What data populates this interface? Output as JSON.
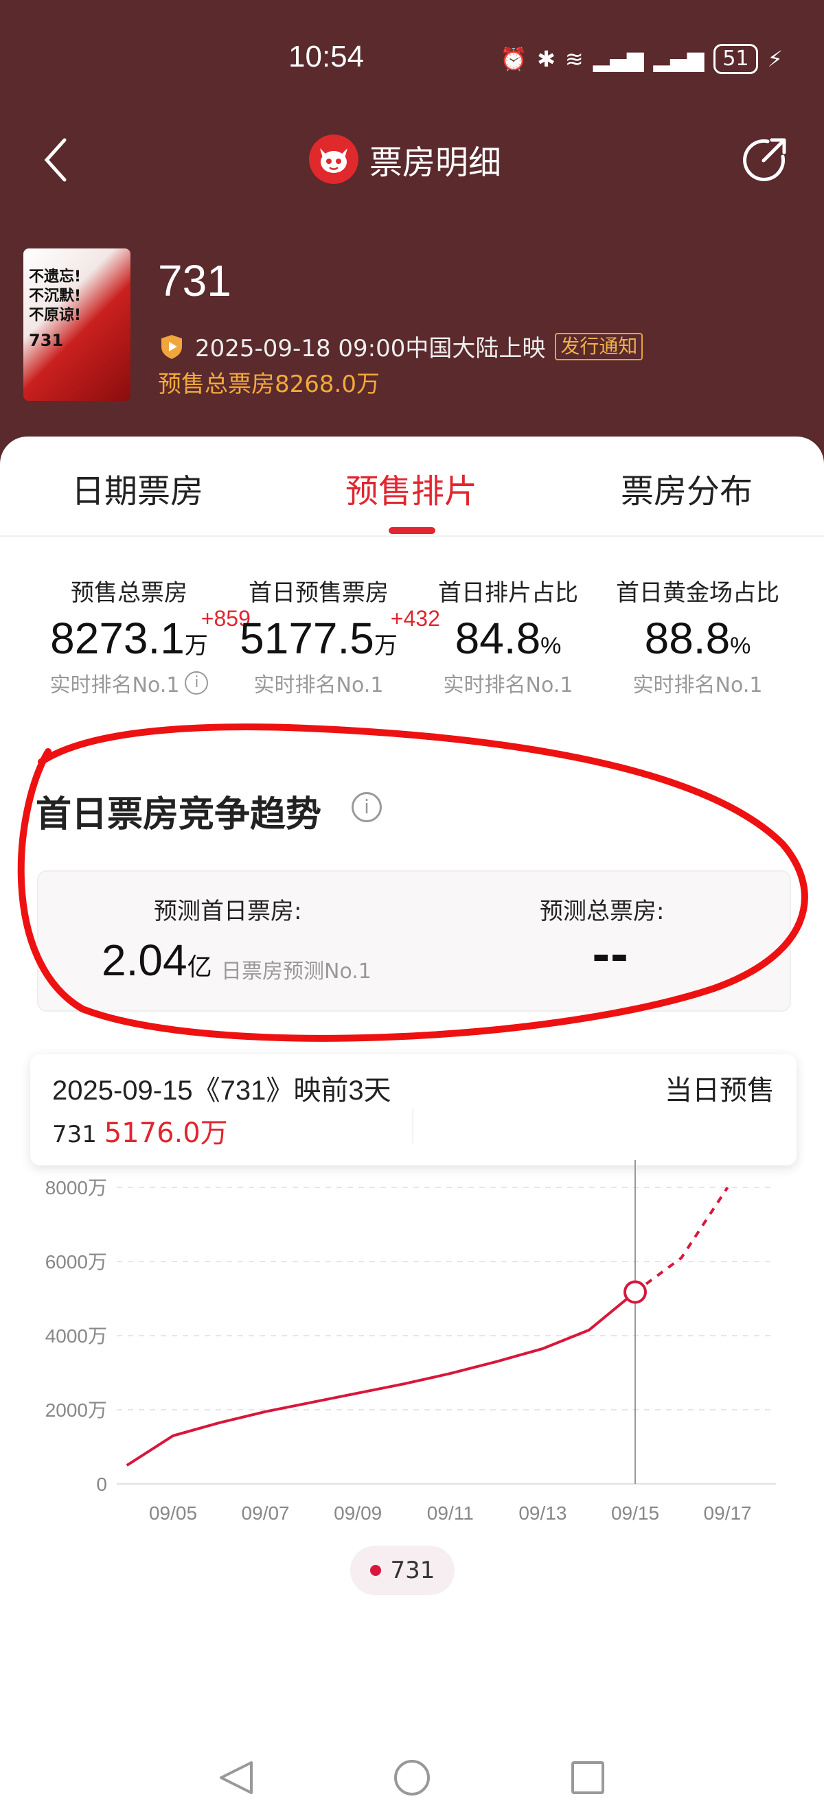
{
  "status": {
    "time": "10:54",
    "battery": "51"
  },
  "nav": {
    "title": "票房明细"
  },
  "movie": {
    "title": "731",
    "release": "2025-09-18 09:00中国大陆上映",
    "notify_badge": "发行通知",
    "presale_total": "预售总票房8268.0万",
    "poster_slogan_lines": [
      "不遗忘!",
      "不沉默!",
      "不原谅!"
    ],
    "poster_title": "731"
  },
  "tabs": [
    {
      "label": "日期票房"
    },
    {
      "label": "预售排片"
    },
    {
      "label": "票房分布"
    }
  ],
  "stats": [
    {
      "label": "预售总票房",
      "value": "8273.1",
      "unit": "万",
      "delta": "+859",
      "rank": "实时排名No.1"
    },
    {
      "label": "首日预售票房",
      "value": "5177.5",
      "unit": "万",
      "delta": "+432",
      "rank": "实时排名No.1"
    },
    {
      "label": "首日排片占比",
      "value": "84.8",
      "unit": "%",
      "delta": "",
      "rank": "实时排名No.1"
    },
    {
      "label": "首日黄金场占比",
      "value": "88.8",
      "unit": "%",
      "delta": "",
      "rank": "实时排名No.1"
    }
  ],
  "trend": {
    "title": "首日票房竞争趋势",
    "predict_first_day_label": "预测首日票房:",
    "predict_first_day_value": "2.04",
    "predict_first_day_unit": "亿",
    "predict_first_day_rank": "日票房预测No.1",
    "predict_total_label": "预测总票房:",
    "predict_total_value": "--"
  },
  "tooltip": {
    "date_line": "2025-09-15《731》映前3天",
    "right_label": "当日预售",
    "series": "731",
    "value": "5176.0万"
  },
  "chart_data": {
    "type": "line",
    "title": "",
    "xlabel": "",
    "ylabel": "",
    "x_ticks": [
      "09/05",
      "09/07",
      "09/09",
      "09/11",
      "09/13",
      "09/15",
      "09/17"
    ],
    "y_ticks": [
      "0",
      "2000万",
      "4000万",
      "6000万",
      "8000万"
    ],
    "ylim": [
      0,
      8000
    ],
    "grid": true,
    "series": [
      {
        "name": "731",
        "color": "#d8173b",
        "x": [
          "09/04",
          "09/05",
          "09/06",
          "09/07",
          "09/08",
          "09/09",
          "09/10",
          "09/11",
          "09/12",
          "09/13",
          "09/14",
          "09/15",
          "09/16",
          "09/17"
        ],
        "values": [
          500,
          1300,
          1650,
          1950,
          2200,
          2450,
          2700,
          2980,
          3300,
          3650,
          4150,
          5176,
          6100,
          8000
        ],
        "projected_from": "09/15"
      }
    ],
    "highlight": {
      "x": "09/15",
      "value": 5176
    }
  },
  "legend": {
    "label": "731"
  }
}
